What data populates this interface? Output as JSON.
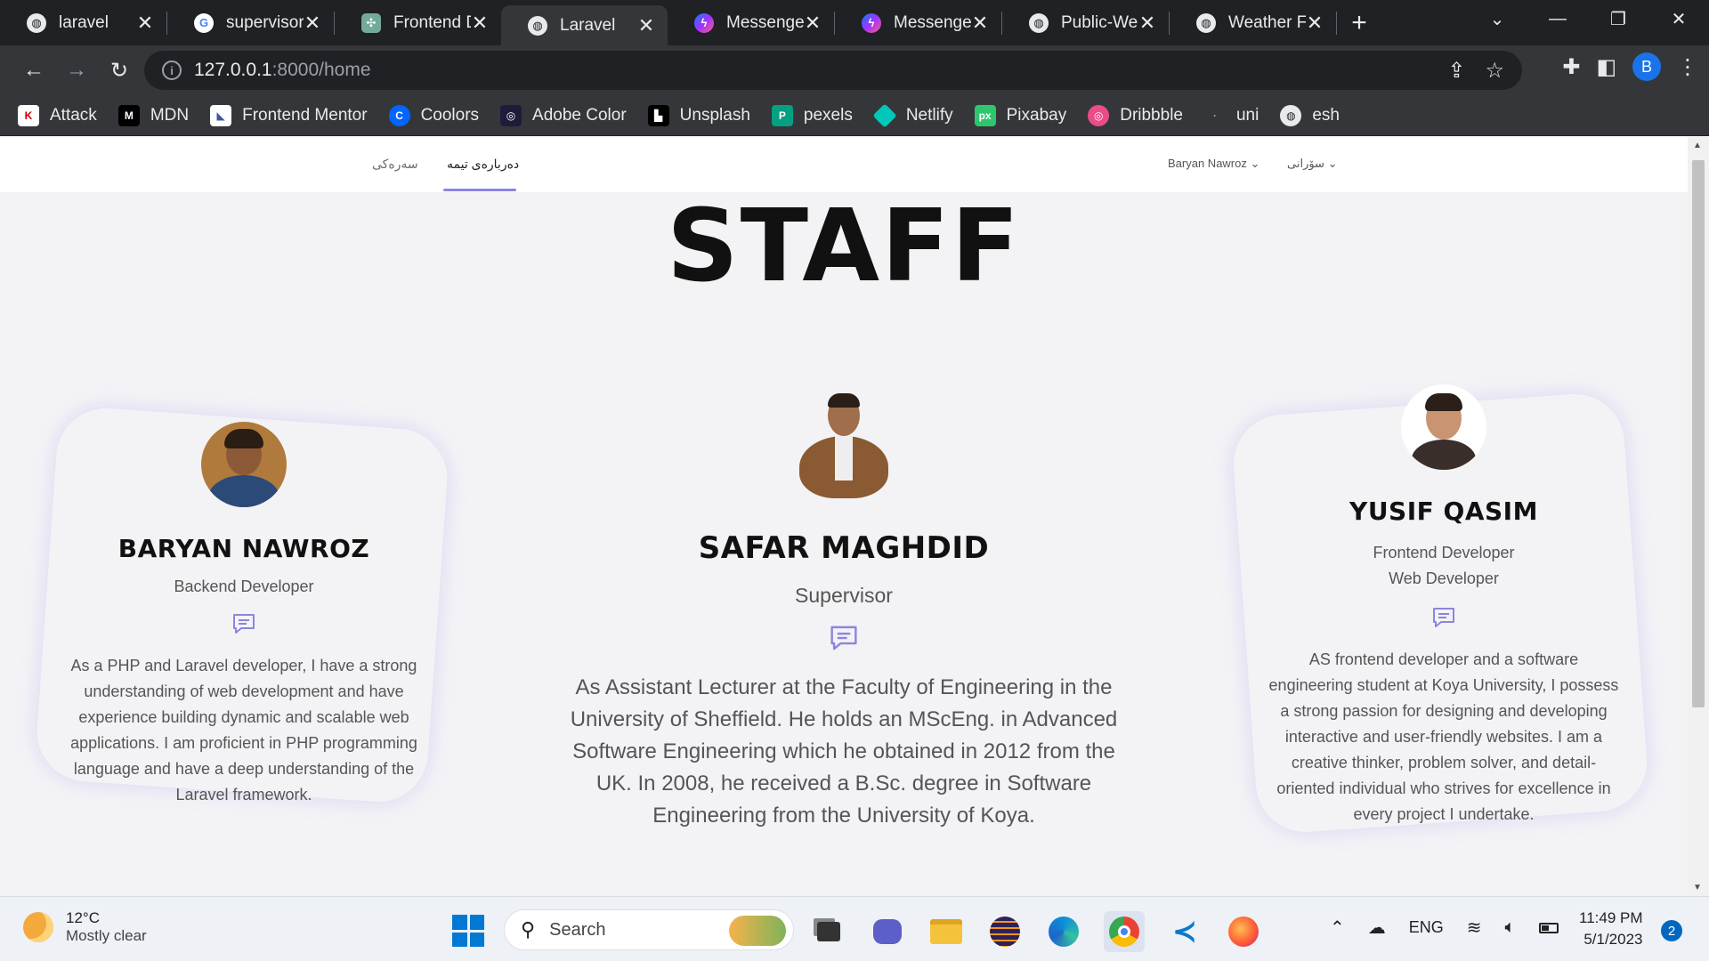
{
  "browser": {
    "tabs": [
      {
        "title": "laravel",
        "favicon": "globe-icon",
        "active": false
      },
      {
        "title": "supervisor - ",
        "favicon": "google-icon",
        "active": false
      },
      {
        "title": "Frontend D",
        "favicon": "chatgpt-icon",
        "active": false
      },
      {
        "title": "Laravel",
        "favicon": "globe-icon",
        "active": true
      },
      {
        "title": "Messenger",
        "favicon": "messenger-icon",
        "active": false
      },
      {
        "title": "Messenger",
        "favicon": "messenger-icon",
        "active": false
      },
      {
        "title": "Public-Wea",
        "favicon": "globe-icon",
        "active": false
      },
      {
        "title": "Weather Fo",
        "favicon": "globe-icon",
        "active": false
      }
    ],
    "url_host": "127.0.0.1",
    "url_rest": ":8000/home",
    "profile_initial": "B",
    "bookmarks": [
      {
        "label": "Attack",
        "icon": "attack-icon"
      },
      {
        "label": "MDN",
        "icon": "mdn-icon"
      },
      {
        "label": "Frontend Mentor",
        "icon": "frontend-mentor-icon"
      },
      {
        "label": "Coolors",
        "icon": "coolors-icon"
      },
      {
        "label": "Adobe Color",
        "icon": "adobe-color-icon"
      },
      {
        "label": "Unsplash",
        "icon": "unsplash-icon"
      },
      {
        "label": "pexels",
        "icon": "pexels-icon"
      },
      {
        "label": "Netlify",
        "icon": "netlify-icon"
      },
      {
        "label": "Pixabay",
        "icon": "pixabay-icon"
      },
      {
        "label": "Dribbble",
        "icon": "dribbble-icon"
      },
      {
        "label": "uni",
        "icon": "uni-icon"
      },
      {
        "label": "esh",
        "icon": "globe-icon"
      }
    ]
  },
  "site_nav": {
    "home_link": "سەرەکی",
    "about_link": "دەربارەی تیمە",
    "user_menu": "Baryan Nawroz",
    "language_menu": "سۆرانی"
  },
  "page": {
    "title": "STAFF",
    "staff": [
      {
        "name": "BARYAN NAWROZ",
        "roles": [
          "Backend Developer"
        ],
        "bio": "As a PHP and Laravel developer, I have a strong understanding of web development and have experience building dynamic and scalable web applications. I am proficient in PHP programming language and have a deep understanding of the Laravel framework."
      },
      {
        "name": "SAFAR MAGHDID",
        "roles": [
          "Supervisor"
        ],
        "bio": "As Assistant Lecturer at the Faculty of Engineering in the University of Sheffield. He holds an MScEng. in Advanced Software Engineering which he obtained in 2012 from the UK. In 2008, he received a B.Sc. degree in Software Engineering from the University of Koya."
      },
      {
        "name": "YUSIF QASIM",
        "roles": [
          "Frontend Developer",
          "Web Developer"
        ],
        "bio": "AS frontend developer and a software engineering student at Koya University, I possess a strong passion for designing and developing interactive and user-friendly websites. I am a creative thinker, problem solver, and detail-oriented individual who strives for excellence in every project I undertake."
      }
    ]
  },
  "taskbar": {
    "weather_temp": "12°C",
    "weather_desc": "Mostly clear",
    "search_placeholder": "Search",
    "language": "ENG",
    "time": "11:49 PM",
    "date": "5/1/2023",
    "notification_count": "2"
  },
  "colors": {
    "accent": "#8b85e0",
    "chrome_dark": "#202124",
    "chrome_toolbar": "#35363a",
    "page_bg": "#f3f3f6"
  }
}
